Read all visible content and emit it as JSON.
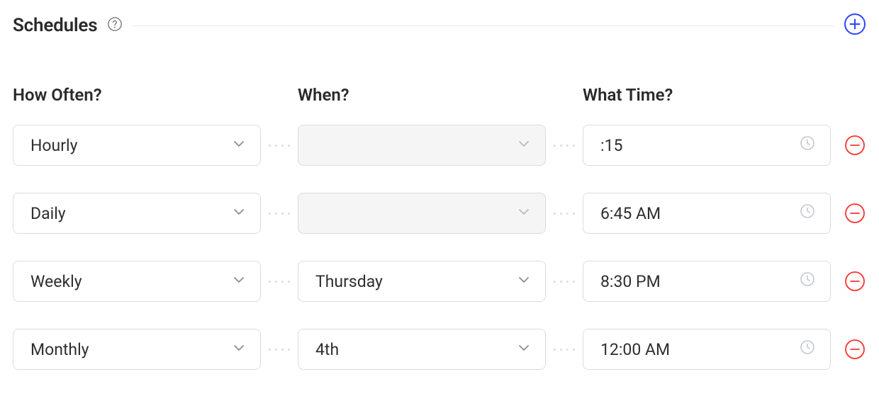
{
  "section": {
    "title": "Schedules"
  },
  "columns": {
    "how_often": "How Often?",
    "when": "When?",
    "what_time": "What Time?"
  },
  "rows": [
    {
      "how_often": "Hourly",
      "when": "",
      "when_disabled": true,
      "time": ":15"
    },
    {
      "how_often": "Daily",
      "when": "",
      "when_disabled": true,
      "time": "6:45 AM"
    },
    {
      "how_often": "Weekly",
      "when": "Thursday",
      "when_disabled": false,
      "time": "8:30 PM"
    },
    {
      "how_often": "Monthly",
      "when": "4th",
      "when_disabled": false,
      "time": "12:00 AM"
    }
  ]
}
